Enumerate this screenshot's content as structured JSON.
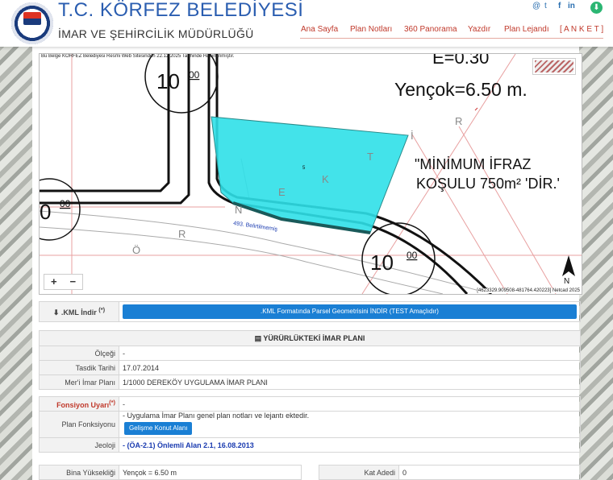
{
  "header": {
    "title": "T.C. KÖRFEZ BELEDİYESİ",
    "subtitle": "İMAR VE ŞEHİRCİLİK MÜDÜRLÜĞÜ",
    "nav": [
      "Ana Sayfa",
      "Plan Notları",
      "360 Panorama",
      "Yazdır",
      "Plan Lejandı",
      "[ A N K E T ]"
    ],
    "social": [
      "@",
      "t",
      "f",
      "in"
    ]
  },
  "map": {
    "note": "Bu Belge KÖRFEZ Belediyesi Resmi Web Sitesinden 22.12.2025 Tarihinde Hazırlanmıştır.",
    "coords": "[4623329.909508-481764.420223] Netcad 2025",
    "labels": {
      "e": "E=0.30",
      "yencok": "Yençok=6.50 m.",
      "min1": "\"MİNİMUM İFRAZ",
      "min2": "KOŞULU 750m² 'DİR.'",
      "road": "493. Belirtilmemiş",
      "n10a": "10",
      "n00a": "00",
      "n0": "0",
      "n00b": "00",
      "n10b": "10",
      "n00c": "00",
      "north": "N",
      "lot": "5",
      "street": [
        "Ö",
        "R",
        "N",
        "E",
        "K",
        "T",
        "İ",
        "R"
      ]
    },
    "zoom_in": "+",
    "zoom_out": "−"
  },
  "kml": {
    "label": ".KML İndir",
    "sup": "(*)",
    "button": ".KML Formatında Parsel Geometrisini İNDİR (TEST Amaçlıdır)"
  },
  "plan": {
    "header": "YÜRÜRLÜKTEKİ İMAR PLANI",
    "rows": [
      {
        "label": "Ölçeği",
        "value": "-"
      },
      {
        "label": "Tasdik Tarihi",
        "value": "17.07.2014"
      },
      {
        "label": "Mer'i İmar Planı",
        "value": "1/1000 DEREKÖY UYGULAMA İMAR PLANI"
      }
    ]
  },
  "fonksiyon": {
    "warn_label": "Fonsiyon Uyarı",
    "warn_sup": "(*)",
    "warn_value": "-",
    "plan_label": "Plan Fonksiyonu",
    "plan_value": "- Uygulama İmar Planı genel plan notları ve lejantı ektedir.",
    "button": "Gelişme Konut Alanı",
    "jeoloji_label": "Jeoloji",
    "jeoloji_value": "- (ÖA-2.1) Önlemli Alan 2.1, 16.08.2013"
  },
  "bina": {
    "label": "Bina Yüksekliği",
    "value": "Yençok = 6.50 m"
  },
  "kat": {
    "label": "Kat Adedi",
    "value": "0"
  }
}
